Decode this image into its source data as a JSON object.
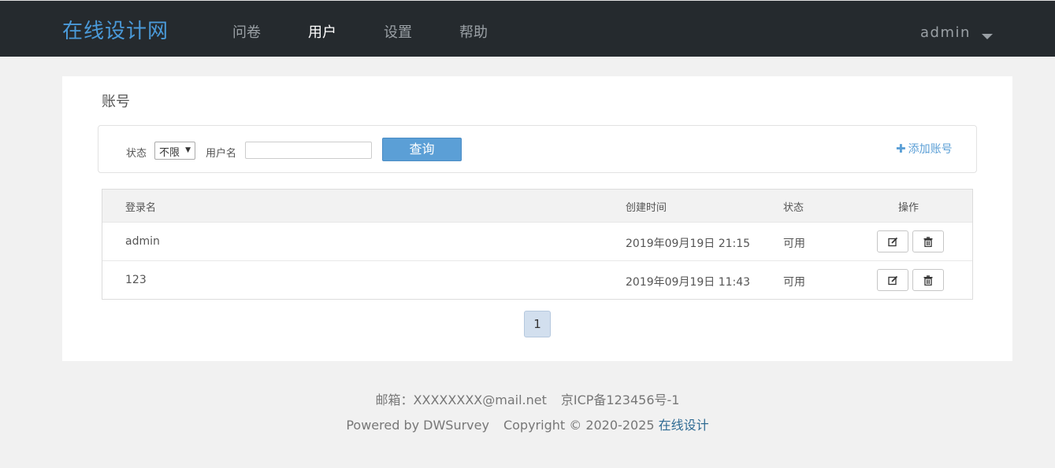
{
  "header": {
    "brand": "在线设计网",
    "nav": [
      {
        "label": "问卷"
      },
      {
        "label": "用户"
      },
      {
        "label": "设置"
      },
      {
        "label": "帮助"
      }
    ],
    "active_nav": "用户",
    "user": "admin"
  },
  "page": {
    "title": "账号"
  },
  "filter": {
    "status_label": "状态",
    "status_value": "不限",
    "username_label": "用户名",
    "username_value": "",
    "query_label": "查询",
    "add_label": "添加账号"
  },
  "table": {
    "columns": [
      "登录名",
      "创建时间",
      "状态",
      "操作"
    ],
    "rows": [
      {
        "name": "admin",
        "created": "2019年09月19日 21:15",
        "status": "可用"
      },
      {
        "name": "123",
        "created": "2019年09月19日 11:43",
        "status": "可用"
      }
    ]
  },
  "pagination": {
    "current": "1"
  },
  "footer": {
    "email": "邮箱：XXXXXXXX@mail.net",
    "icp": "京ICP备123456号-1",
    "powered": "Powered by DWSurvey",
    "copyright": "Copyright © 2020-2025",
    "site_link": "在线设计"
  },
  "icons": {
    "edit": "edit-icon",
    "delete": "trash-icon",
    "add": "plus-icon",
    "user_menu": "chevron-down-icon"
  }
}
